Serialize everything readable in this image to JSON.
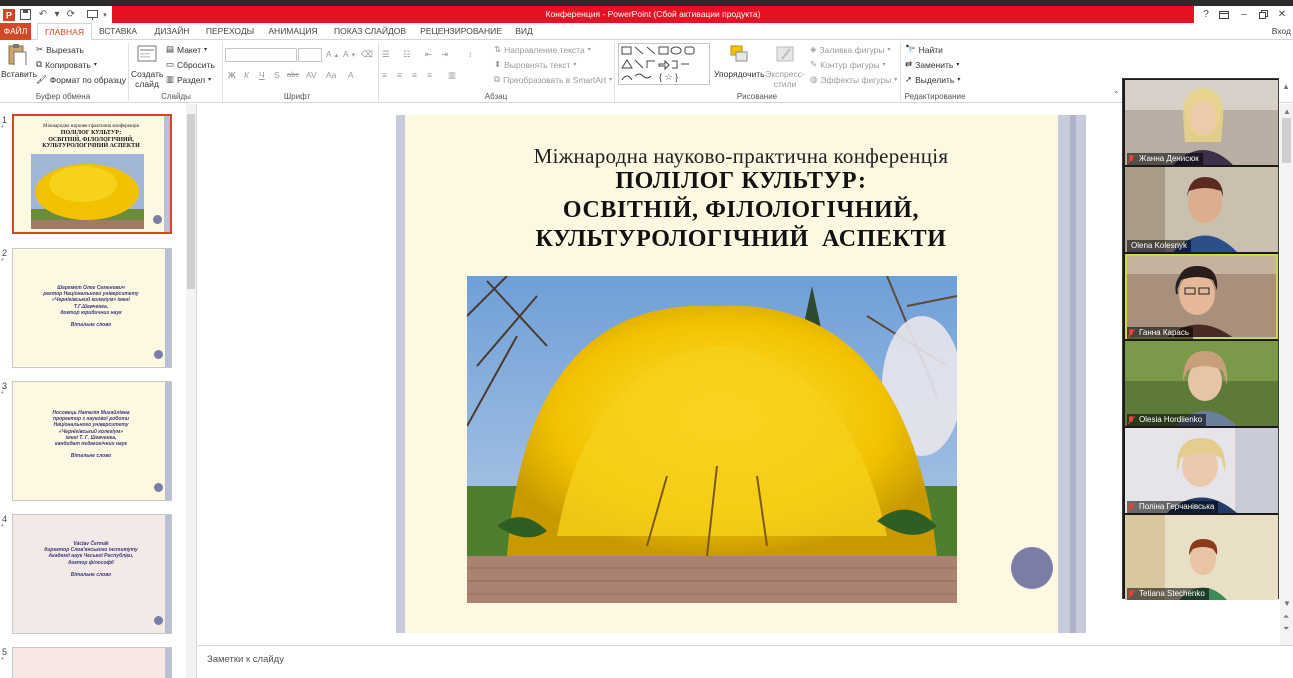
{
  "window": {
    "title": "Конференция - PowerPoint (Сбой активации продукта)",
    "help": "?",
    "login": "Вход"
  },
  "tabs": [
    "ФАЙЛ",
    "ГЛАВНАЯ",
    "ВСТАВКА",
    "ДИЗАЙН",
    "ПЕРЕХОДЫ",
    "АНИМАЦИЯ",
    "ПОКАЗ СЛАЙДОВ",
    "РЕЦЕНЗИРОВАНИЕ",
    "ВИД"
  ],
  "ribbon": {
    "clipboard": {
      "label": "Буфер обмена",
      "paste": "Вставить",
      "cut": "Вырезать",
      "copy": "Копировать",
      "format_painter": "Формат по образцу"
    },
    "slides": {
      "label": "Слайды",
      "new_slide_1": "Создать",
      "new_slide_2": "слайд",
      "layout": "Макет",
      "reset": "Сбросить",
      "section": "Раздел"
    },
    "font": {
      "label": "Шрифт",
      "bold": "Ж",
      "italic": "К",
      "underline": "Ч",
      "shadow": "S",
      "strike": "abc",
      "case": "Aa"
    },
    "paragraph": {
      "label": "Абзац",
      "text_direction": "Направление текста",
      "align_text": "Выровнять текст",
      "smartart": "Преобразовать в SmartArt"
    },
    "drawing": {
      "label": "Рисование",
      "arrange": "Упорядочить",
      "quick_styles_1": "Экспресс-",
      "quick_styles_2": "стили",
      "shape_fill": "Заливка фигуры",
      "shape_outline": "Контур фигуры",
      "shape_effects": "Эффекты фигуры"
    },
    "editing": {
      "label": "Редактирование",
      "find": "Найти",
      "replace": "Заменить",
      "select": "Выделить"
    }
  },
  "thumbnails": [
    {
      "num": "1",
      "star": "*",
      "text": [
        "Міжнародна науково-практична конференція",
        "ПОЛІЛОГ КУЛЬТУР:",
        "ОСВІТНІЙ, ФІЛОЛОГІЧНИЙ,",
        "КУЛЬТУРОЛОГІЧНИЙ АСПЕКТИ"
      ]
    },
    {
      "num": "2",
      "star": "*",
      "text": [
        "Шеремет Олег Семенович",
        "ректор Національного університету",
        "«Чернігівський колегіум» імені",
        "Т.Г.Шевченка,",
        "доктор юридичних наук",
        "",
        "Вітальне слово"
      ]
    },
    {
      "num": "3",
      "star": "*",
      "text": [
        "Носовець Наталія Михайлівна",
        "проректор з наукової роботи",
        "Національного університету",
        "«Чернігівський колегіум»",
        "імені Т. Г. Шевченка,",
        "кандидат педагогічних наук",
        "",
        "Вітальне слово"
      ]
    },
    {
      "num": "4",
      "star": "*",
      "text": [
        "Václav Čermák",
        "директор Слов'янського інституту",
        "Академії наук Чеської Республіки,",
        "доктор філософії",
        "",
        "Вітальне слово"
      ]
    },
    {
      "num": "5",
      "star": "*",
      "text": []
    }
  ],
  "slide": {
    "subtitle": "Міжнародна науково-практична конференція",
    "title_lines": [
      "ПОЛІЛОГ КУЛЬТУР:",
      "ОСВІТНІЙ, ФІЛОЛОГІЧНИЙ,",
      "КУЛЬТУРОЛОГІЧНИЙ  АСПЕКТИ"
    ]
  },
  "notes_placeholder": "Заметки к слайду",
  "participants": [
    {
      "name": "Жанна Денисюк",
      "active": false
    },
    {
      "name": "Olena Kolesnyk",
      "active": false
    },
    {
      "name": "Ганна Карась",
      "active": true
    },
    {
      "name": "Olesia Hordiienko",
      "active": false
    },
    {
      "name": "Поліна Герчанівська",
      "active": false
    },
    {
      "name": "Tetiana Stechenko",
      "active": false
    }
  ],
  "colors": {
    "accent": "#d24726",
    "titlebar": "#e81123",
    "slide_bg": "#fdf8e2",
    "slide_bar": "#c7cbdc",
    "slide_dot": "#7a7ea6",
    "forsythia": "#f2c200"
  }
}
